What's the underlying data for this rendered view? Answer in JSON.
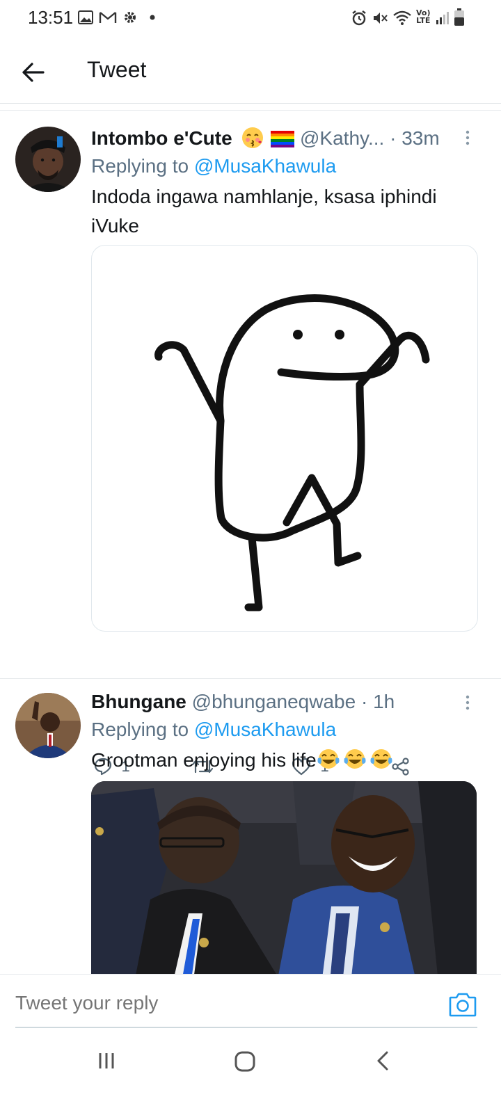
{
  "status_bar": {
    "time": "13:51",
    "left_icons": [
      "gallery-icon",
      "gmail-icon",
      "settings-icon",
      "dot-icon"
    ],
    "right_icons": [
      "alarm-icon",
      "mute-icon",
      "wifi-icon",
      "volte-icon",
      "signal-icon",
      "battery-icon"
    ],
    "volte_label_top": "Vo)",
    "volte_label_bottom": "LTE"
  },
  "app_bar": {
    "back_icon": "back-arrow-icon",
    "title": "Tweet"
  },
  "tweets": [
    {
      "name": "Intombo e'Cute",
      "emojis": [
        "kissing-face-emoji",
        "rainbow-flag-emoji"
      ],
      "handle": "@Kathy...",
      "separator": "·",
      "time": "33m",
      "replying_prefix": "Replying to",
      "replying_to": "@MusaKhawula",
      "text": "Indoda ingawa namhlanje, ksasa iphindi iVuke",
      "media": "stick-figure-drawing",
      "actions": {
        "reply_count": "1",
        "retweet_count": "",
        "like_count": "1"
      }
    },
    {
      "name": "Bhungane",
      "handle": "@bhunganeqwabe",
      "separator": "·",
      "time": "1h",
      "replying_prefix": "Replying to",
      "replying_to": "@MusaKhawula",
      "text": "Grootman enjoying his life",
      "text_emojis": [
        "tears-of-joy-emoji",
        "tears-of-joy-emoji",
        "tears-of-joy-emoji"
      ],
      "media": "two-men-laughing-photo"
    }
  ],
  "reply_bar": {
    "placeholder": "Tweet your reply",
    "camera_icon": "camera-icon"
  },
  "nav_bar": {
    "buttons": [
      "recents-icon",
      "home-icon",
      "back-icon"
    ]
  },
  "colors": {
    "accent": "#1d9bf0",
    "secondary_text": "#5b7083",
    "primary_text": "#14171a"
  }
}
